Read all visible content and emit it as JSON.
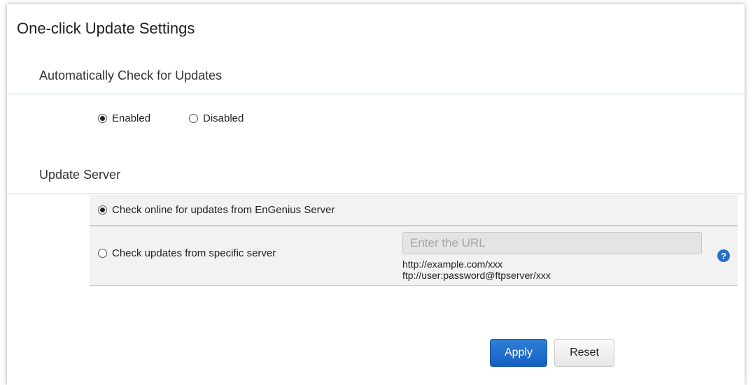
{
  "title": "One-click Update Settings",
  "auto_check": {
    "heading": "Automatically Check for Updates",
    "options": [
      {
        "label": "Enabled",
        "checked": true
      },
      {
        "label": "Disabled",
        "checked": false
      }
    ]
  },
  "update_server": {
    "heading": "Update Server",
    "online_option": {
      "label": "Check online for updates from EnGenius Server",
      "checked": true
    },
    "specific_option": {
      "label": "Check updates from specific server",
      "checked": false
    },
    "url_input": {
      "value": "",
      "placeholder": "Enter the URL"
    },
    "hints": [
      "http://example.com/xxx",
      "ftp://user:password@ftpserver/xxx"
    ],
    "help_icon": "?"
  },
  "buttons": {
    "apply": "Apply",
    "reset": "Reset"
  },
  "colors": {
    "accent": "#1560c0",
    "divider": "#b9d1e3",
    "help": "#2a6fc8"
  }
}
